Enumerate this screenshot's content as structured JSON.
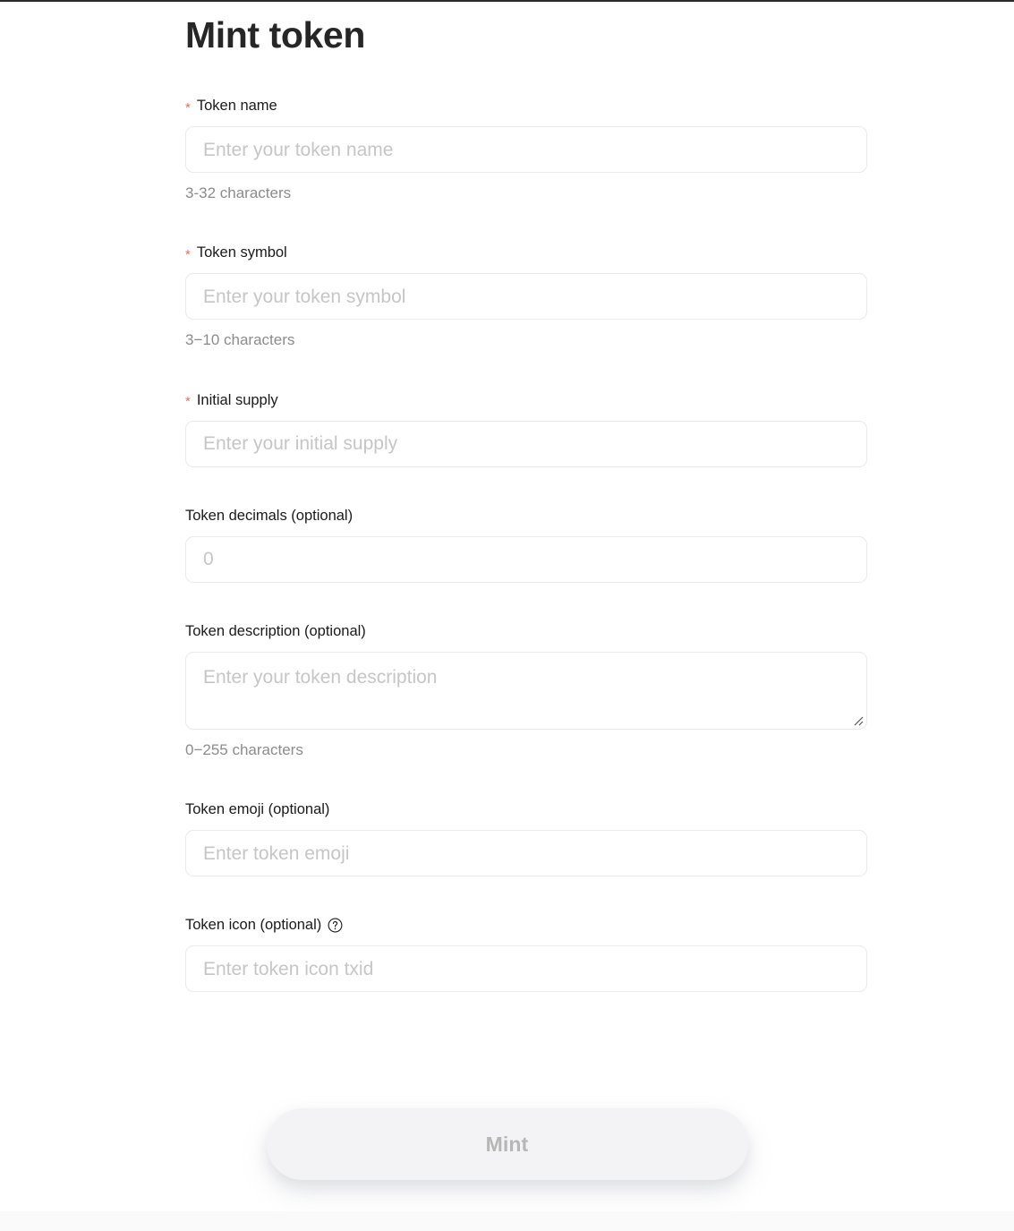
{
  "page": {
    "title": "Mint token",
    "required_marker": "*",
    "accent_required_color": "#f4685f",
    "text_color": "#1a1a1a",
    "hint_color": "#8c8c8c",
    "placeholder_color": "#c6c6c6",
    "border_color": "#eaeaea",
    "background": "#ffffff"
  },
  "form": {
    "fields": [
      {
        "name": "token-name",
        "label": "Token name",
        "required": true,
        "placeholder": "Enter your token name",
        "value": "",
        "hint": "3-32 characters",
        "control": "text"
      },
      {
        "name": "token-symbol",
        "label": "Token symbol",
        "required": true,
        "placeholder": "Enter your token symbol",
        "value": "",
        "hint": "3−10 characters",
        "control": "text"
      },
      {
        "name": "initial-supply",
        "label": "Initial supply",
        "required": true,
        "placeholder": "Enter your initial supply",
        "value": "",
        "hint": "",
        "control": "text"
      },
      {
        "name": "token-decimals",
        "label": "Token decimals (optional)",
        "required": false,
        "placeholder": "0",
        "value": "",
        "hint": "",
        "control": "text"
      },
      {
        "name": "token-description",
        "label": "Token description (optional)",
        "required": false,
        "placeholder": "Enter your token description",
        "value": "",
        "hint": "0−255 characters",
        "control": "textarea"
      },
      {
        "name": "token-emoji",
        "label": "Token emoji (optional)",
        "required": false,
        "placeholder": "Enter token emoji",
        "value": "",
        "hint": "",
        "control": "text"
      },
      {
        "name": "token-icon",
        "label": "Token icon (optional)",
        "required": false,
        "placeholder": "Enter token icon txid",
        "value": "",
        "hint": "",
        "control": "text",
        "help_icon": "question-circle-icon"
      }
    ]
  },
  "submit": {
    "label": "Mint",
    "disabled": true,
    "background": "#f3f3f5",
    "text_color": "#b6b6b6"
  }
}
